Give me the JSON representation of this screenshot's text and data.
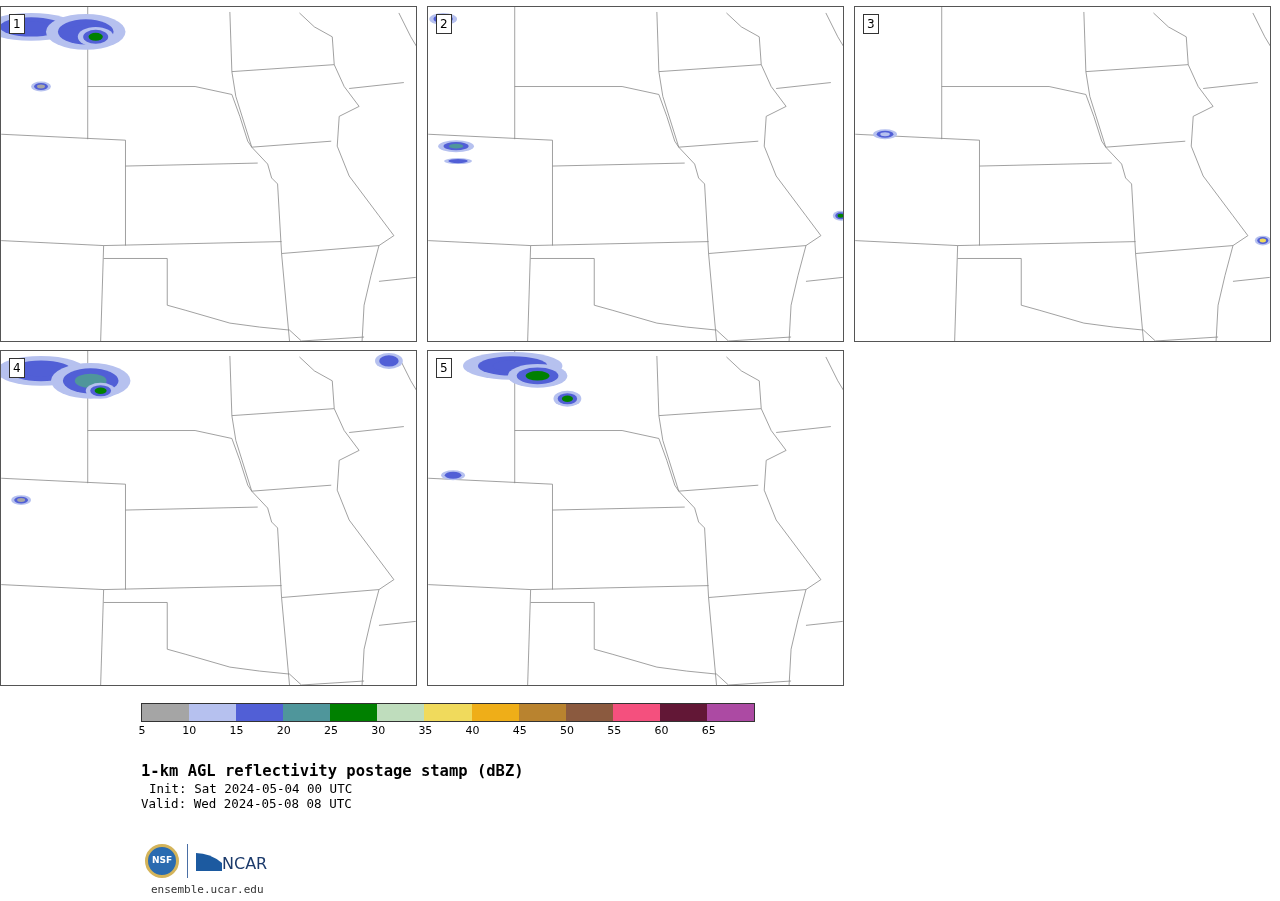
{
  "panels": [
    {
      "label": "1"
    },
    {
      "label": "2"
    },
    {
      "label": "3"
    },
    {
      "label": "4"
    },
    {
      "label": "5"
    }
  ],
  "colorbar": {
    "bins": [
      {
        "label": "5",
        "color": "#a5a5a5"
      },
      {
        "label": "10",
        "color": "#b6c1ef"
      },
      {
        "label": "15",
        "color": "#515fd6"
      },
      {
        "label": "20",
        "color": "#4f969b"
      },
      {
        "label": "25",
        "color": "#008000"
      },
      {
        "label": "30",
        "color": "#bfddbd"
      },
      {
        "label": "35",
        "color": "#f0da5c"
      },
      {
        "label": "40",
        "color": "#efae18"
      },
      {
        "label": "45",
        "color": "#b9832f"
      },
      {
        "label": "50",
        "color": "#8b5a3f"
      },
      {
        "label": "55",
        "color": "#f4507e"
      },
      {
        "label": "60",
        "color": "#621736"
      },
      {
        "label": "65",
        "color": "#ac4aa3"
      }
    ]
  },
  "title": "1-km AGL reflectivity postage stamp (dBZ)",
  "init": "Init: Sat 2024-05-04 00 UTC",
  "valid": "Valid: Wed 2024-05-08 08 UTC",
  "logos": {
    "nsf": "NSF",
    "ncar": "NCAR"
  },
  "url": "ensemble.ucar.edu"
}
